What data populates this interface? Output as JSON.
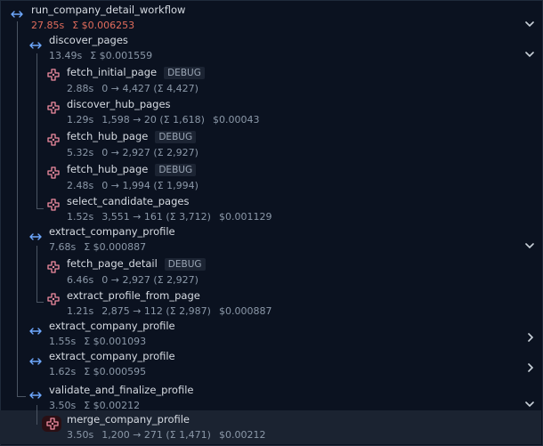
{
  "colors": {
    "background": "#0b1220",
    "accent_blue": "#6ea8fe",
    "llm_pink": "#f08ca0",
    "cost_red": "#e06c5c",
    "highlight": "#1b2331"
  },
  "tree": [
    {
      "id": "root",
      "name": "run_company_detail_workflow",
      "duration": "27.85s",
      "cost": "Σ $0.006253",
      "icon": "arrows-horizontal-icon",
      "chevron": "chevron-down-icon"
    },
    {
      "id": "discover",
      "name": "discover_pages",
      "duration": "13.49s",
      "cost": "Σ $0.001559",
      "icon": "arrows-horizontal-icon",
      "chevron": "chevron-down-icon"
    },
    {
      "id": "fetch_initial",
      "name": "fetch_initial_page",
      "badge": "DEBUG",
      "duration": "2.88s",
      "tokens": "0 → 4,427 (Σ 4,427)",
      "icon": "llm-icon"
    },
    {
      "id": "discover_hub",
      "name": "discover_hub_pages",
      "duration": "1.29s",
      "tokens": "1,598 → 20 (Σ 1,618)",
      "price": "$0.00043",
      "icon": "llm-icon"
    },
    {
      "id": "fetch_hub_1",
      "name": "fetch_hub_page",
      "badge": "DEBUG",
      "duration": "5.32s",
      "tokens": "0 → 2,927 (Σ 2,927)",
      "icon": "llm-icon"
    },
    {
      "id": "fetch_hub_2",
      "name": "fetch_hub_page",
      "badge": "DEBUG",
      "duration": "2.48s",
      "tokens": "0 → 1,994 (Σ 1,994)",
      "icon": "llm-icon"
    },
    {
      "id": "select_candidate",
      "name": "select_candidate_pages",
      "duration": "1.52s",
      "tokens": "3,551 → 161 (Σ 3,712)",
      "price": "$0.001129",
      "icon": "llm-icon"
    },
    {
      "id": "extract_1",
      "name": "extract_company_profile",
      "duration": "7.68s",
      "cost": "Σ $0.000887",
      "icon": "arrows-horizontal-icon",
      "chevron": "chevron-down-icon"
    },
    {
      "id": "fetch_detail",
      "name": "fetch_page_detail",
      "badge": "DEBUG",
      "duration": "6.46s",
      "tokens": "0 → 2,927 (Σ 2,927)",
      "icon": "llm-icon"
    },
    {
      "id": "extract_from_page",
      "name": "extract_profile_from_page",
      "duration": "1.21s",
      "tokens": "2,875 → 112 (Σ 2,987)",
      "price": "$0.000887",
      "icon": "llm-icon"
    },
    {
      "id": "extract_2",
      "name": "extract_company_profile",
      "duration": "1.55s",
      "cost": "Σ $0.001093",
      "icon": "arrows-horizontal-icon",
      "chevron": "chevron-right-icon"
    },
    {
      "id": "extract_3",
      "name": "extract_company_profile",
      "duration": "1.62s",
      "cost": "Σ $0.000595",
      "icon": "arrows-horizontal-icon",
      "chevron": "chevron-right-icon"
    },
    {
      "id": "validate",
      "name": "validate_and_finalize_profile",
      "duration": "3.50s",
      "cost": "Σ $0.00212",
      "icon": "arrows-horizontal-icon",
      "chevron": "chevron-down-icon"
    },
    {
      "id": "merge",
      "name": "merge_company_profile",
      "duration": "3.50s",
      "tokens": "1,200 → 271 (Σ 1,471)",
      "price": "$0.00212",
      "icon": "llm-icon",
      "selected": true
    }
  ]
}
